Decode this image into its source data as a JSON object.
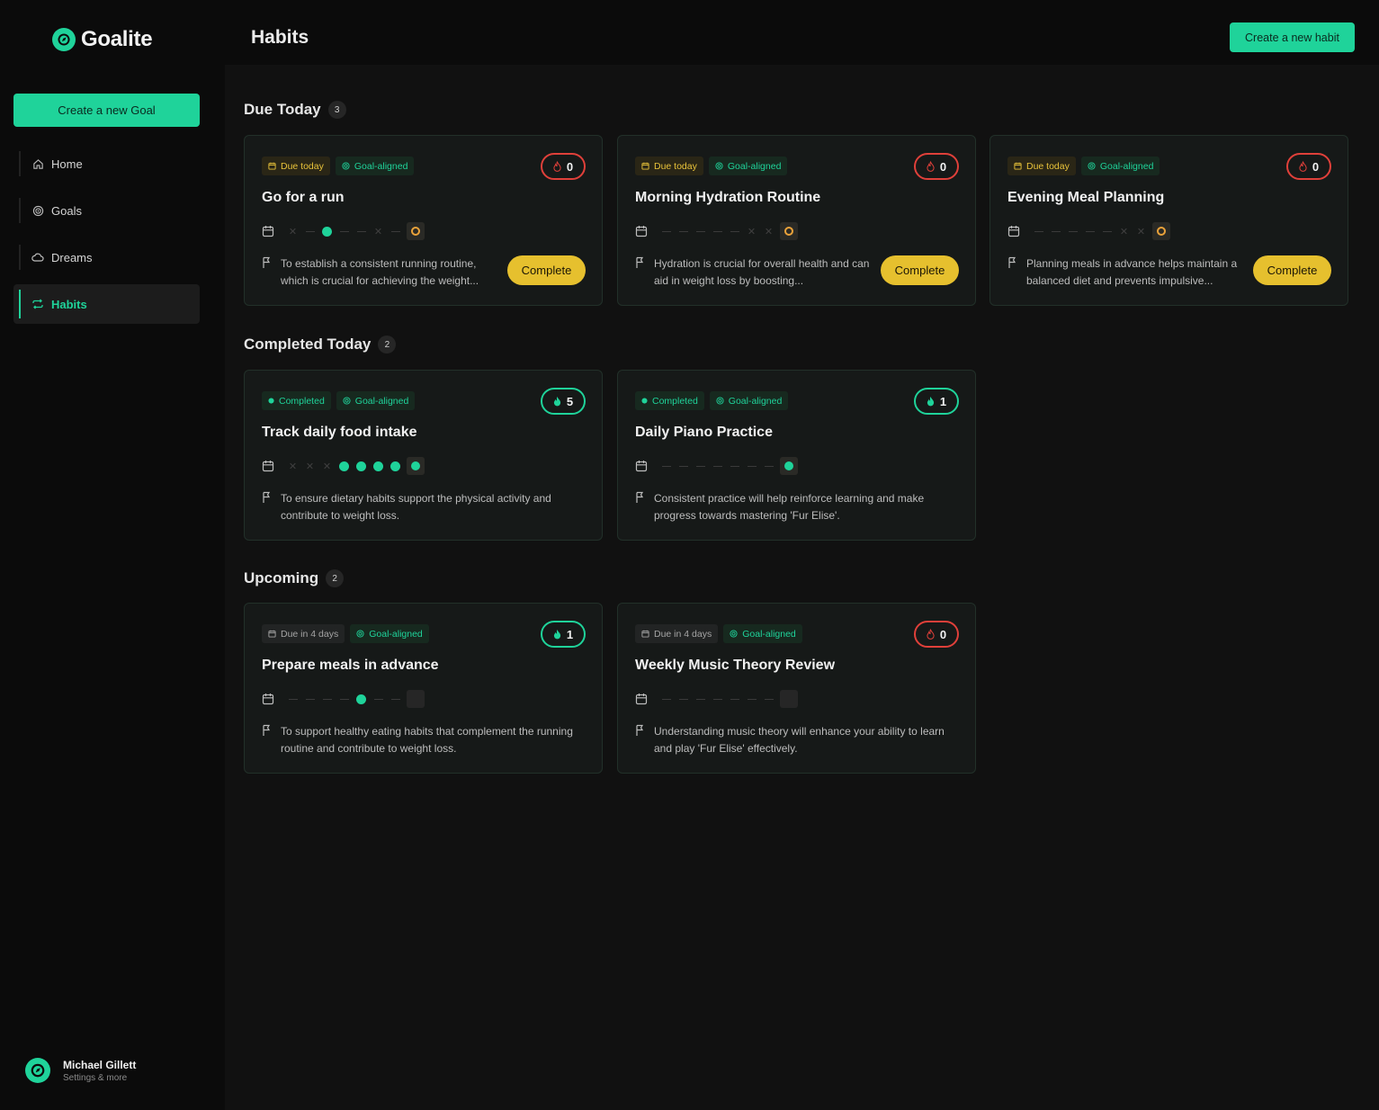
{
  "app": {
    "name": "Goalite"
  },
  "sidebar": {
    "create_goal_label": "Create a new Goal",
    "items": [
      {
        "label": "Home",
        "icon": "home-icon"
      },
      {
        "label": "Goals",
        "icon": "target-icon"
      },
      {
        "label": "Dreams",
        "icon": "cloud-icon"
      },
      {
        "label": "Habits",
        "icon": "repeat-icon",
        "active": true
      }
    ],
    "user": {
      "name": "Michael Gillett",
      "subtitle": "Settings & more"
    }
  },
  "header": {
    "title": "Habits",
    "create_habit_label": "Create a new habit"
  },
  "sections": {
    "due": {
      "title": "Due Today",
      "count": "3"
    },
    "completed": {
      "title": "Completed Today",
      "count": "2"
    },
    "upcoming": {
      "title": "Upcoming",
      "count": "2"
    }
  },
  "cards": [
    {
      "status": "Due today",
      "aligned": "Goal-aligned",
      "streak": "0",
      "title": "Go for a run",
      "description": "To establish a consistent running routine, which is crucial for achieving the weight...",
      "button": "Complete"
    },
    {
      "status": "Due today",
      "aligned": "Goal-aligned",
      "streak": "0",
      "title": "Morning Hydration Routine",
      "description": "Hydration is crucial for overall health and can aid in weight loss by boosting...",
      "button": "Complete"
    },
    {
      "status": "Due today",
      "aligned": "Goal-aligned",
      "streak": "0",
      "title": "Evening Meal Planning",
      "description": "Planning meals in advance helps maintain a balanced diet and prevents impulsive...",
      "button": "Complete"
    },
    {
      "status": "Completed",
      "aligned": "Goal-aligned",
      "streak": "5",
      "title": "Track daily food intake",
      "description": "To ensure dietary habits support the physical activity and contribute to weight loss."
    },
    {
      "status": "Completed",
      "aligned": "Goal-aligned",
      "streak": "1",
      "title": "Daily Piano Practice",
      "description": "Consistent practice will help reinforce learning and make progress towards mastering 'Fur Elise'."
    },
    {
      "status": "Due in 4 days",
      "aligned": "Goal-aligned",
      "streak": "1",
      "title": "Prepare meals in advance",
      "description": "To support healthy eating habits that complement the running routine and contribute to weight loss."
    },
    {
      "status": "Due in 4 days",
      "aligned": "Goal-aligned",
      "streak": "0",
      "title": "Weekly Music Theory Review",
      "description": "Understanding music theory will enhance your ability to learn and play 'Fur Elise' effectively."
    }
  ],
  "colors": {
    "accent": "#1fd39a",
    "due": "#e9c33a",
    "streak_broken": "#e0403a",
    "complete_button": "#e6c02e"
  }
}
